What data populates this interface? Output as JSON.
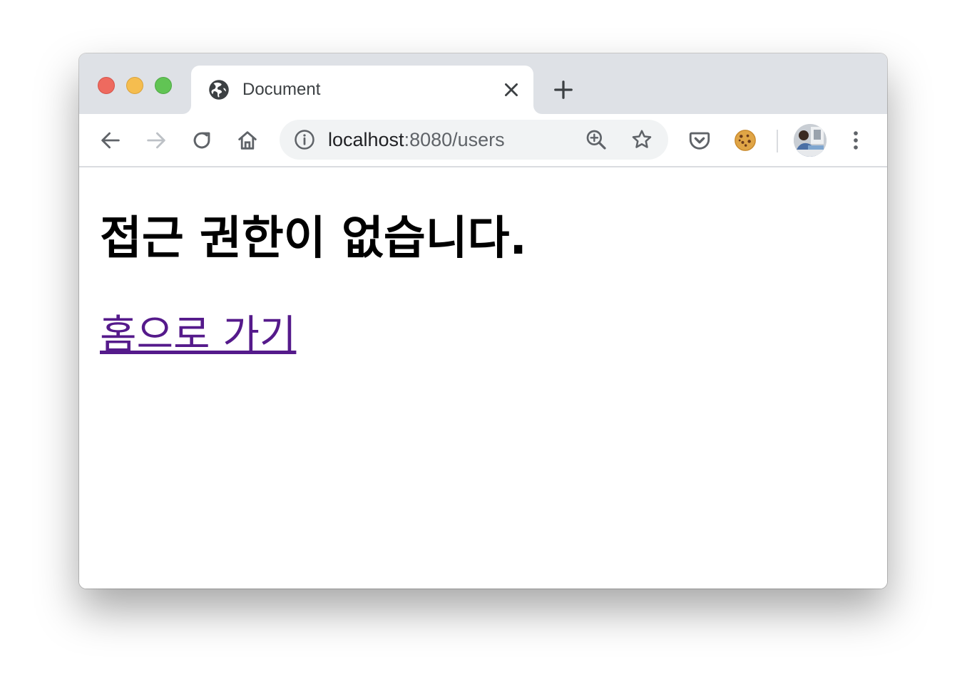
{
  "browser": {
    "tab": {
      "title": "Document",
      "favicon_icon": "globe-icon",
      "close_icon": "close-icon"
    },
    "new_tab_icon": "plus-icon",
    "toolbar": {
      "back_icon": "arrow-left-icon",
      "forward_icon": "arrow-right-icon",
      "reload_icon": "reload-icon",
      "home_icon": "home-icon",
      "extensions": [
        "pocket-icon",
        "cookie-icon"
      ],
      "menu_icon": "kebab-menu-icon"
    },
    "omnibox": {
      "info_icon": "info-icon",
      "host": "localhost",
      "path": ":8080/users",
      "zoom_icon": "zoom-in-icon",
      "bookmark_icon": "star-icon"
    },
    "traffic_lights": {
      "close_color": "#ee6a5f",
      "minimize_color": "#f5bd4f",
      "maximize_color": "#61c454"
    }
  },
  "page": {
    "heading": "접근 권한이 없습니다.",
    "home_link": "홈으로 가기",
    "link_color": "#551a8b"
  }
}
